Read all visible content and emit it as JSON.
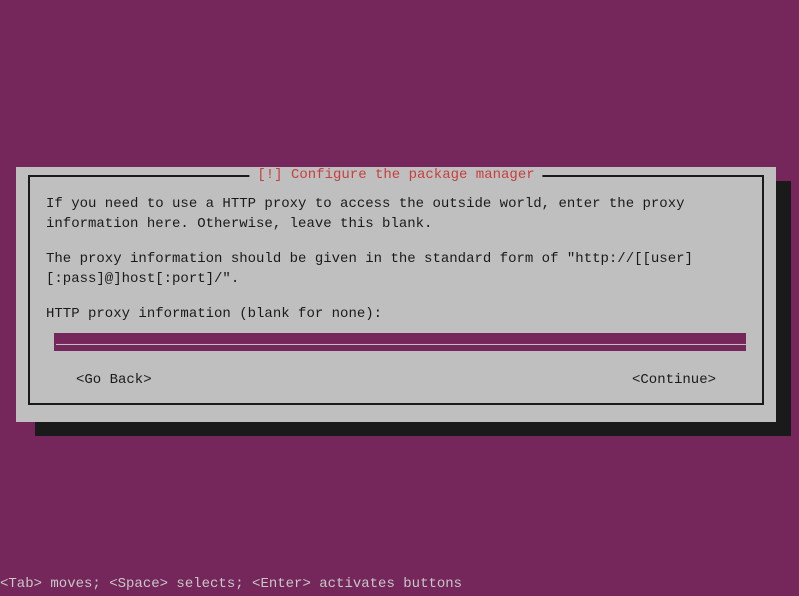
{
  "dialog": {
    "title": "[!] Configure the package manager",
    "paragraph1": "If you need to use a HTTP proxy to access the outside world, enter the proxy information here. Otherwise, leave this blank.",
    "paragraph2": "The proxy information should be given in the standard form of \"http://[[user][:pass]@]host[:port]/\".",
    "prompt": "HTTP proxy information (blank for none):",
    "input_value": "_______________________________________________________________________________________",
    "go_back_label": "<Go Back>",
    "continue_label": "<Continue>"
  },
  "footer": {
    "hint": "<Tab> moves; <Space> selects; <Enter> activates buttons"
  }
}
